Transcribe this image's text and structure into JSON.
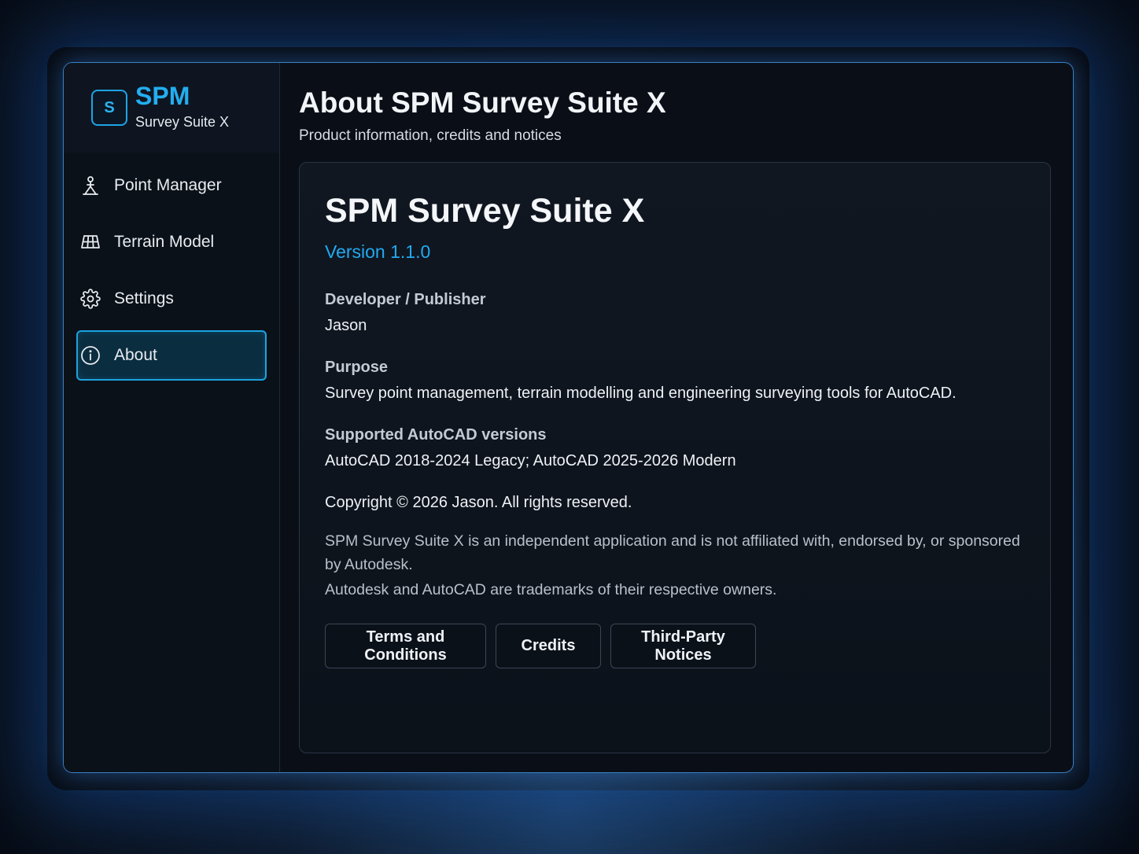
{
  "brand": {
    "mark": "S",
    "title": "SPM",
    "subtitle": "Survey Suite X"
  },
  "sidebar": {
    "items": [
      {
        "label": "Point Manager",
        "icon": "surveyor-icon"
      },
      {
        "label": "Terrain Model",
        "icon": "terrain-grid-icon"
      },
      {
        "label": "Settings",
        "icon": "gear-icon"
      },
      {
        "label": "About",
        "icon": "info-icon",
        "active": true
      }
    ]
  },
  "header": {
    "title": "About SPM Survey Suite X",
    "subtitle": "Product information, credits and notices"
  },
  "about": {
    "product_name": "SPM Survey Suite X",
    "version": "Version 1.1.0",
    "developer_label": "Developer / Publisher",
    "developer_value": "Jason",
    "purpose_label": "Purpose",
    "purpose_value": "Survey point management, terrain modelling and engineering surveying tools for AutoCAD.",
    "versions_label": "Supported AutoCAD versions",
    "versions_value": "AutoCAD 2018-2024 Legacy; AutoCAD 2025-2026 Modern",
    "copyright": "Copyright © 2026 Jason. All rights reserved.",
    "disclaimer_1": "SPM Survey Suite X is an independent application and is not affiliated with, endorsed by, or sponsored by Autodesk.",
    "disclaimer_2": "Autodesk and AutoCAD are trademarks of their respective owners."
  },
  "buttons": {
    "terms": "Terms and Conditions",
    "credits": "Credits",
    "third_party": "Third-Party Notices"
  },
  "colors": {
    "accent": "#22aaf0",
    "window_border": "#3a7fc2",
    "active_bg": "#0b2d40"
  }
}
